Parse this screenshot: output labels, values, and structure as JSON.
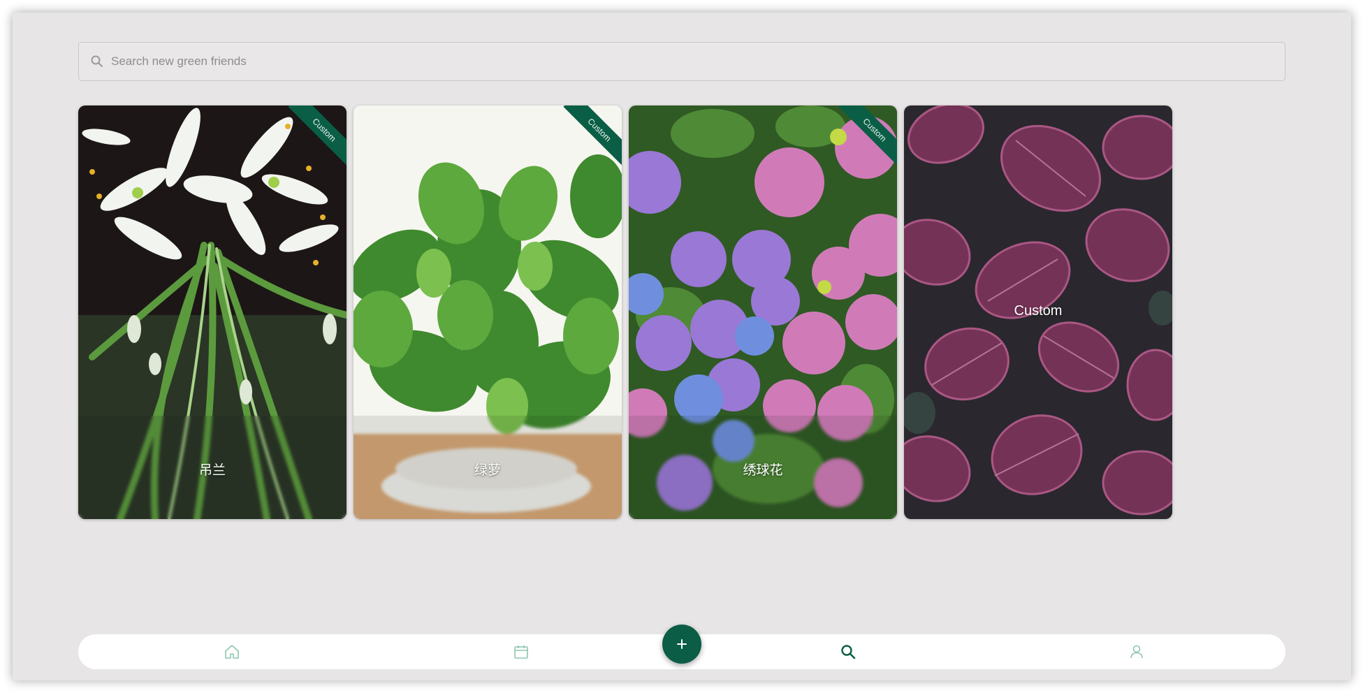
{
  "search": {
    "placeholder": "Search new green friends",
    "value": ""
  },
  "plants": [
    {
      "name": "吊兰",
      "badge": "Custom",
      "image": "white-spider-plant-flowers"
    },
    {
      "name": "绿萝",
      "badge": "Custom",
      "image": "green-pothos-in-pot"
    },
    {
      "name": "绣球花",
      "badge": "Custom",
      "image": "pink-and-blue-hydrangeas"
    }
  ],
  "custom_card": {
    "label": "Custom",
    "image": "pink-veined-leaves-blurred"
  },
  "nav": {
    "items": [
      {
        "icon": "home-icon",
        "active": false
      },
      {
        "icon": "calendar-icon",
        "active": false
      },
      {
        "icon": "search-icon",
        "active": true
      },
      {
        "icon": "user-icon",
        "active": false
      }
    ],
    "fab_icon": "plus-icon"
  },
  "colors": {
    "accent": "#0b5d45",
    "nav_inactive": "#8fc5ad",
    "nav_active": "#0b5d45",
    "background": "#e7e5e5"
  }
}
